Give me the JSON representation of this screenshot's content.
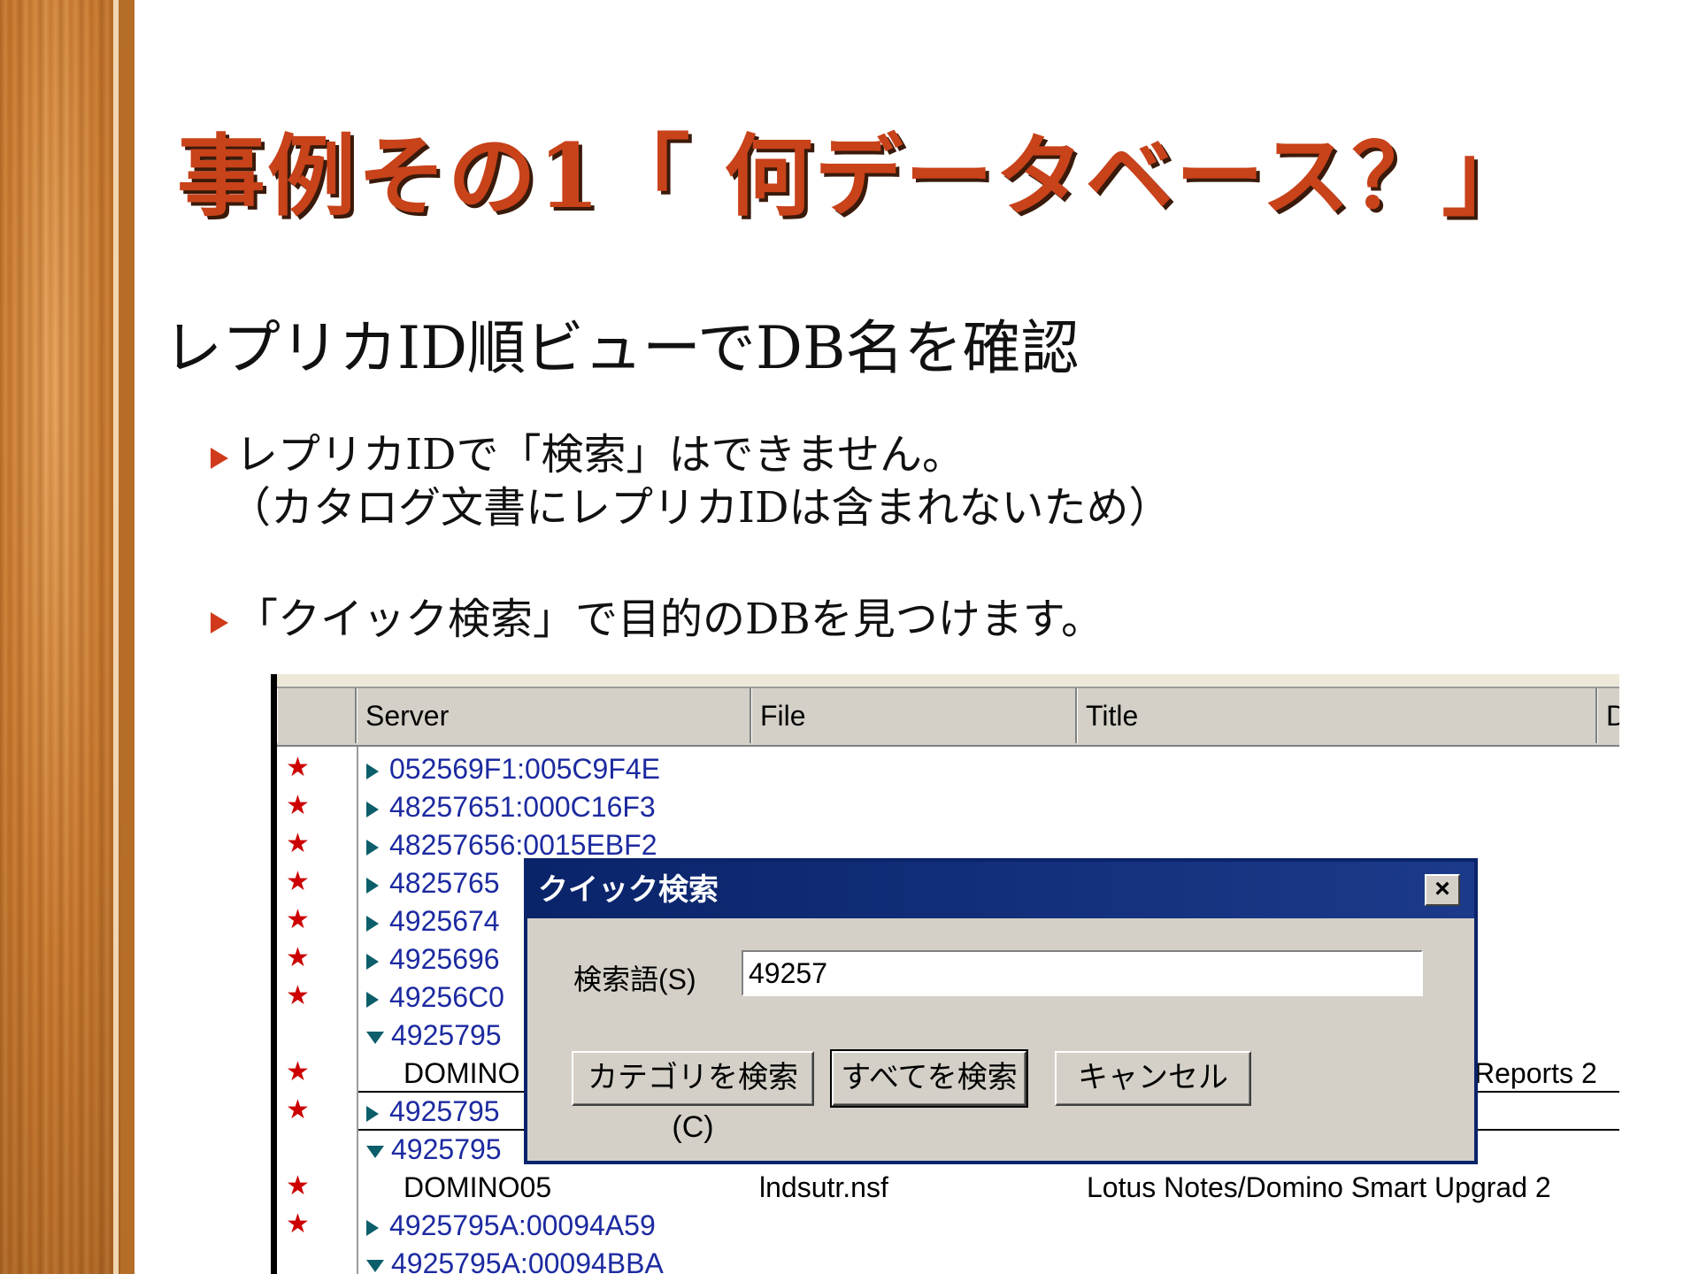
{
  "slide": {
    "title": "事例その1「 何データベース？」",
    "subtitle": "レプリカID順ビューでDB名を確認",
    "bullet1_line1": "レプリカIDで「検索」はできません。",
    "bullet1_line2": "（カタログ文書にレプリカIDは含まれないため）",
    "bullet2": "「クイック検索」で目的のDBを見つけます。"
  },
  "view": {
    "columns": [
      "Server",
      "File",
      "Title",
      "D"
    ],
    "rows": [
      {
        "star": "★",
        "type": "cat",
        "state": "collapsed",
        "label": "052569F1:005C9F4E"
      },
      {
        "star": "★",
        "type": "cat",
        "state": "collapsed",
        "label": "48257651:000C16F3"
      },
      {
        "star": "★",
        "type": "cat",
        "state": "collapsed",
        "label": "48257656:0015EBF2"
      },
      {
        "star": "★",
        "type": "cat",
        "state": "collapsed",
        "label": "4825765"
      },
      {
        "star": "★",
        "type": "cat",
        "state": "collapsed",
        "label": "4925674"
      },
      {
        "star": "★",
        "type": "cat",
        "state": "collapsed",
        "label": "4925696"
      },
      {
        "star": "★",
        "type": "cat",
        "state": "collapsed",
        "label": "49256C0"
      },
      {
        "star": "",
        "type": "cat",
        "state": "expanded",
        "label": "4925795"
      },
      {
        "star": "★",
        "type": "doc",
        "server": "DOMINO",
        "file": "",
        "title": "Reports 2"
      },
      {
        "star": "★",
        "type": "cat",
        "state": "collapsed",
        "label": "4925795"
      },
      {
        "star": "",
        "type": "cat",
        "state": "expanded",
        "label": "4925795"
      },
      {
        "star": "★",
        "type": "doc",
        "server": "DOMINO05",
        "file": "lndsutr.nsf",
        "title": "Lotus Notes/Domino Smart Upgrad 2"
      },
      {
        "star": "★",
        "type": "cat",
        "state": "collapsed",
        "label": "4925795A:00094A59"
      },
      {
        "star": "",
        "type": "cat",
        "state": "expanded",
        "label": "4925795A:00094BBA"
      }
    ]
  },
  "dialog": {
    "title": "クイック検索",
    "close": "×",
    "label": "検索語(S)",
    "value": "49257",
    "buttons": [
      "カテゴリを検索(C)",
      "すべてを検索",
      "キャンセル"
    ]
  }
}
